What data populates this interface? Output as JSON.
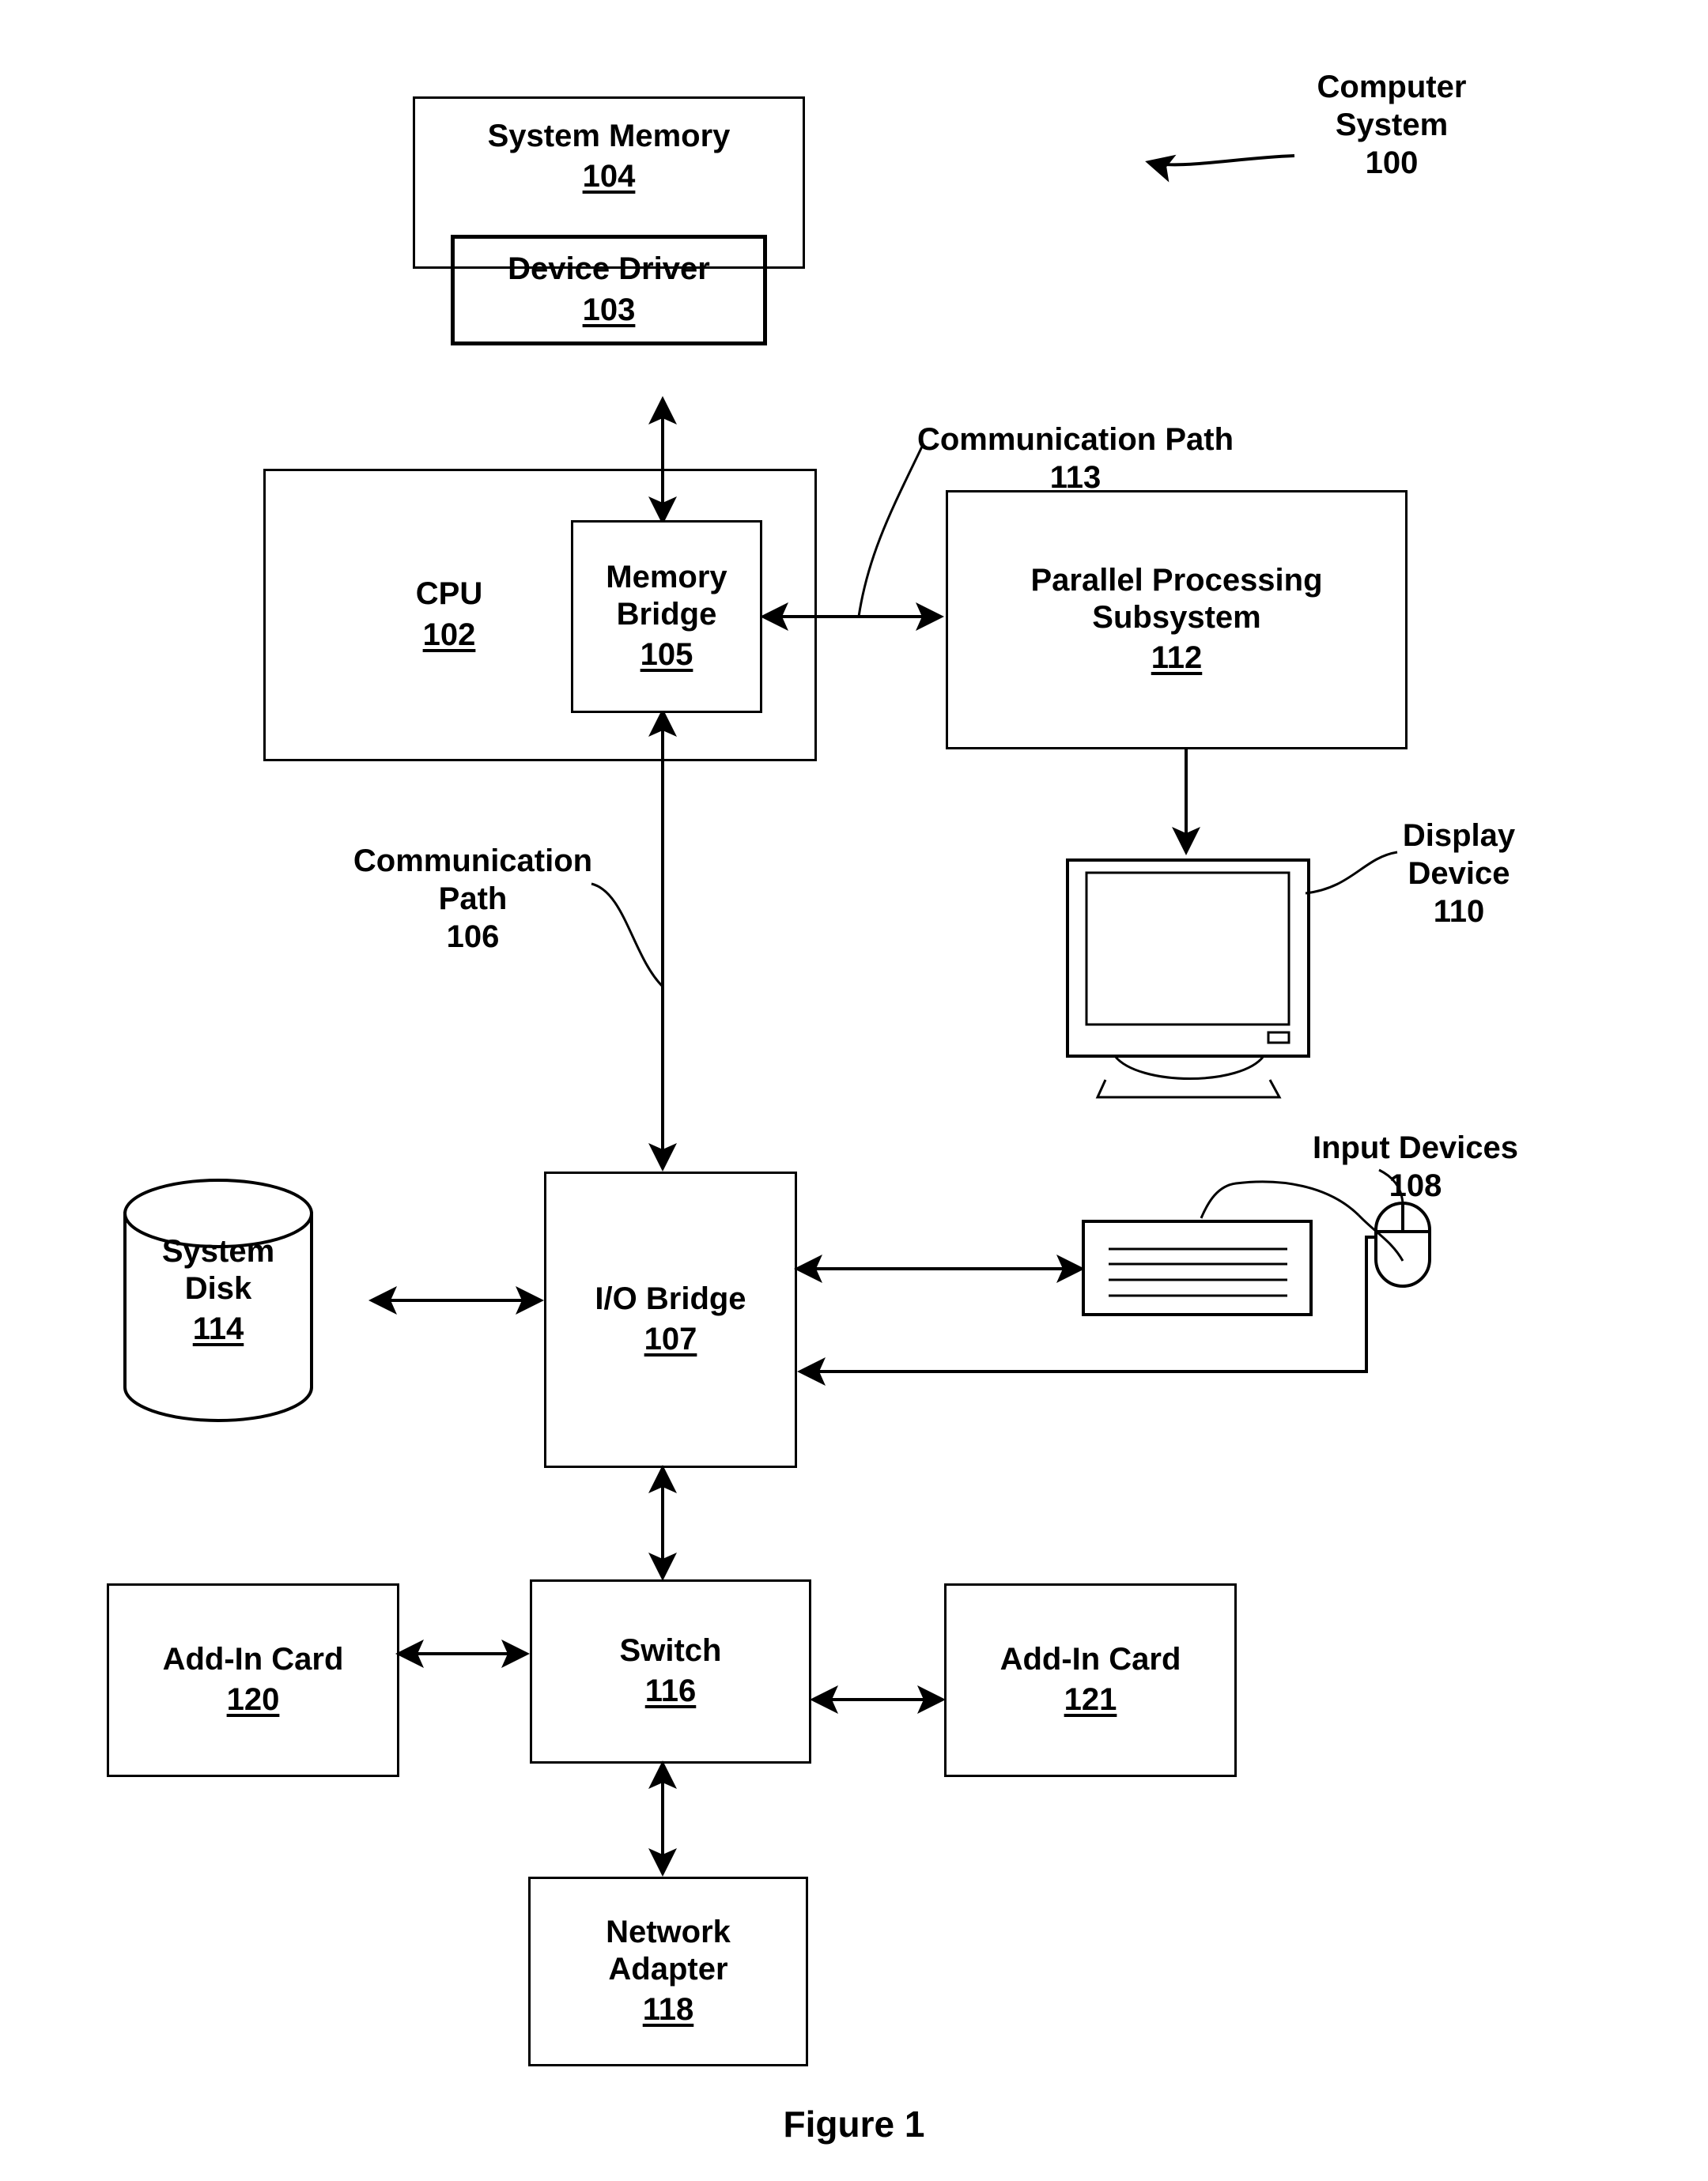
{
  "figure": {
    "caption": "Figure 1"
  },
  "diagram": {
    "type": "block-diagram",
    "title": "Computer System 100 block diagram",
    "nodes": [
      {
        "id": "104",
        "label": "System Memory",
        "ref": "104",
        "shape": "rect"
      },
      {
        "id": "103",
        "label": "Device Driver",
        "ref": "103",
        "shape": "rect"
      },
      {
        "id": "102",
        "label": "CPU",
        "ref": "102",
        "shape": "rect"
      },
      {
        "id": "105",
        "label": "Memory\nBridge",
        "ref": "105",
        "shape": "rect"
      },
      {
        "id": "112",
        "label": "Parallel Processing\nSubsystem",
        "ref": "112",
        "shape": "rect"
      },
      {
        "id": "110",
        "label": "Display\nDevice",
        "ref": "110",
        "shape": "monitor"
      },
      {
        "id": "108",
        "label": "Input Devices",
        "ref": "108",
        "shape": "keyboard-mouse"
      },
      {
        "id": "114",
        "label": "System\nDisk",
        "ref": "114",
        "shape": "cylinder"
      },
      {
        "id": "107",
        "label": "I/O Bridge",
        "ref": "107",
        "shape": "rect"
      },
      {
        "id": "120",
        "label": "Add-In Card",
        "ref": "120",
        "shape": "rect"
      },
      {
        "id": "116",
        "label": "Switch",
        "ref": "116",
        "shape": "rect"
      },
      {
        "id": "121",
        "label": "Add-In Card",
        "ref": "121",
        "shape": "rect"
      },
      {
        "id": "118",
        "label": "Network\nAdapter",
        "ref": "118",
        "shape": "rect"
      }
    ],
    "callouts": [
      {
        "id": "100",
        "label": "Computer\nSystem",
        "ref": "100"
      },
      {
        "id": "113",
        "label": "Communication Path",
        "ref": "113"
      },
      {
        "id": "106",
        "label": "Communication\nPath",
        "ref": "106"
      },
      {
        "id": "110",
        "label": "Display\nDevice",
        "ref": "110"
      },
      {
        "id": "108",
        "label": "Input Devices",
        "ref": "108"
      }
    ],
    "edges": [
      {
        "from": "105",
        "to": "104",
        "style": "double-arrow"
      },
      {
        "from": "105",
        "to": "112",
        "style": "double-arrow",
        "label_ref": "113"
      },
      {
        "from": "112",
        "to": "110",
        "style": "arrow"
      },
      {
        "from": "105",
        "to": "107",
        "style": "double-arrow",
        "label_ref": "106"
      },
      {
        "from": "107",
        "to": "114",
        "style": "double-arrow"
      },
      {
        "from": "107",
        "to": "108-keyboard",
        "style": "double-arrow"
      },
      {
        "from": "108-mouse",
        "to": "107",
        "style": "arrow"
      },
      {
        "from": "107",
        "to": "116",
        "style": "double-arrow"
      },
      {
        "from": "116",
        "to": "120",
        "style": "double-arrow"
      },
      {
        "from": "116",
        "to": "121",
        "style": "double-arrow"
      },
      {
        "from": "116",
        "to": "118",
        "style": "double-arrow"
      }
    ]
  },
  "blocks": {
    "system_memory": {
      "title": "System Memory",
      "ref": "104"
    },
    "device_driver": {
      "title": "Device Driver",
      "ref": "103"
    },
    "cpu": {
      "title": "CPU",
      "ref": "102"
    },
    "memory_bridge": {
      "title": "Memory\nBridge",
      "ref": "105"
    },
    "parallel_subsys": {
      "title": "Parallel Processing\nSubsystem",
      "ref": "112"
    },
    "io_bridge": {
      "title": "I/O Bridge",
      "ref": "107"
    },
    "system_disk": {
      "title": "System\nDisk",
      "ref": "114"
    },
    "add_in_card_left": {
      "title": "Add-In Card",
      "ref": "120"
    },
    "switch": {
      "title": "Switch",
      "ref": "116"
    },
    "add_in_card_right": {
      "title": "Add-In Card",
      "ref": "121"
    },
    "network_adapter": {
      "title": "Network\nAdapter",
      "ref": "118"
    }
  },
  "labels": {
    "computer_system": {
      "title": "Computer\nSystem",
      "ref": "100"
    },
    "comm_path_113": {
      "title": "Communication Path",
      "ref": "113"
    },
    "comm_path_106": {
      "title": "Communication\nPath",
      "ref": "106"
    },
    "display_device": {
      "title": "Display\nDevice",
      "ref": "110"
    },
    "input_devices": {
      "title": "Input Devices",
      "ref": "108"
    }
  },
  "colors": {
    "ink": "#000000",
    "paper": "#ffffff"
  }
}
